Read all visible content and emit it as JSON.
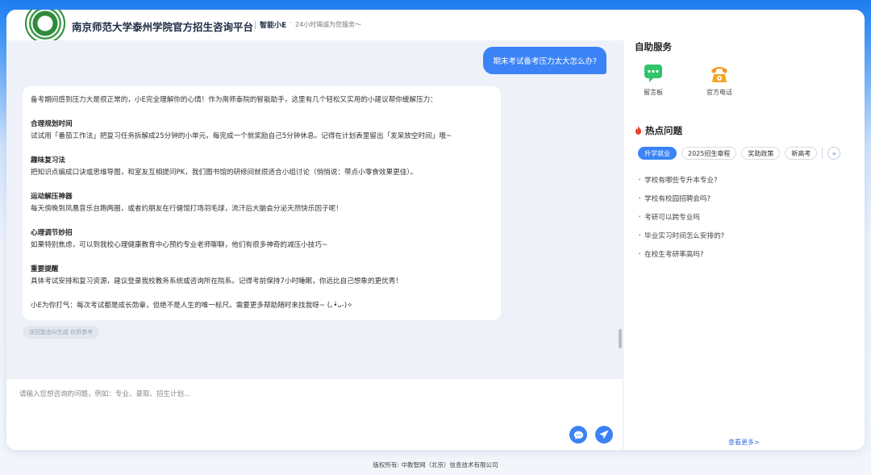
{
  "header": {
    "title": "南京师范大学泰州学院官方招生咨询平台",
    "brand": "智能小E",
    "dot": "·",
    "subtitle": "24小时竭诚为您服务～"
  },
  "chat": {
    "user_message": "期末考试备考压力太大怎么办?",
    "ai_message": {
      "intro": "备考期间感到压力大是很正常的，小E完全理解你的心情！作为南师泰院的智能助手，这里有几个轻松又实用的小建议帮你缓解压力：",
      "sections": [
        {
          "heading": "合理规划时间",
          "body": "试试用「番茄工作法」把复习任务拆解成25分钟的小单元，每完成一个就奖励自己5分钟休息。记得在计划表里留出「发呆放空时间」哦~"
        },
        {
          "heading": "趣味复习法",
          "body": "把知识点编成口诀或思维导图，和室友互相提问PK，我们图书馆的研修间就很适合小组讨论（悄悄说：带点小零食效果更佳）。"
        },
        {
          "heading": "运动解压神器",
          "body": "每天傍晚到凤凰音乐台跑两圈，或者约朋友在行健馆打场羽毛球，流汗后大脑会分泌天然快乐因子呢！"
        },
        {
          "heading": "心理调节妙招",
          "body": "如果特别焦虑，可以到我校心理健康教育中心预约专业老师聊聊，他们有很多神奇的减压小技巧~"
        },
        {
          "heading": "重要提醒",
          "body": "具体考试安排和复习资源，建议登录我校教务系统或咨询所在院系。记得考前保持7小时睡眠，你远比自己想象的更优秀！"
        }
      ],
      "closing": "小E为你打气：每次考试都是成长勋章，但绝不是人生的唯一标尺。需要更多帮助随时来找我呀~ (｡•̀ᴗ-)✧"
    },
    "ai_note": "该回复由AI生成 仅供参考"
  },
  "input": {
    "placeholder": "请输入您想咨询的问题，例如：专业、录取、招生计划...",
    "value": ""
  },
  "sidebar": {
    "self_service_title": "自助服务",
    "services": [
      {
        "label": "留言板",
        "icon": "message-board-icon",
        "color": "#31c46b"
      },
      {
        "label": "官方电话",
        "icon": "phone-icon",
        "color": "#f29a1b"
      }
    ],
    "hot_title": "热点问题",
    "tabs": [
      {
        "label": "升学就业",
        "active": true
      },
      {
        "label": "2025招生章程",
        "active": false
      },
      {
        "label": "奖助政策",
        "active": false
      },
      {
        "label": "新高考",
        "active": false
      }
    ],
    "questions": [
      "学校有哪些专升本专业?",
      "学校有校园招聘会吗?",
      "考研可以跨专业吗",
      "毕业实习时间怎么安排的?",
      "在校生考研率高吗?"
    ],
    "see_more": "查看更多>"
  },
  "footer": {
    "copyright": "版权所有: 中教智网（北京）信息技术有限公司"
  },
  "colors": {
    "accent": "#3b83f6",
    "header_gradient": "#1f7cf0",
    "chat_bg": "#eef2f8",
    "hot_icon": "#e8412c"
  }
}
